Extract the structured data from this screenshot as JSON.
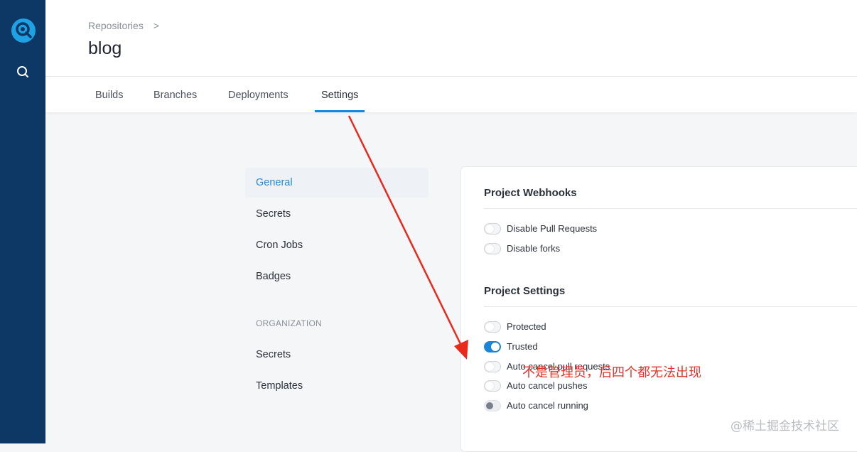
{
  "sidebar": {
    "logo_icon": "drone-logo-icon",
    "search_icon": "search-icon"
  },
  "header": {
    "breadcrumb": "Repositories",
    "breadcrumb_separator": ">",
    "title": "blog"
  },
  "tabs": [
    {
      "label": "Builds"
    },
    {
      "label": "Branches"
    },
    {
      "label": "Deployments"
    },
    {
      "label": "Settings",
      "active": true
    }
  ],
  "settings_nav": {
    "items": [
      {
        "label": "General",
        "active": true
      },
      {
        "label": "Secrets"
      },
      {
        "label": "Cron Jobs"
      },
      {
        "label": "Badges"
      }
    ],
    "org_section_label": "ORGANIZATION",
    "org_items": [
      {
        "label": "Secrets"
      },
      {
        "label": "Templates"
      }
    ]
  },
  "panel": {
    "webhooks_title": "Project Webhooks",
    "webhooks_options": [
      {
        "label": "Disable Pull Requests",
        "state": "off"
      },
      {
        "label": "Disable forks",
        "state": "off"
      }
    ],
    "settings_title": "Project Settings",
    "settings_options": [
      {
        "label": "Protected",
        "state": "off"
      },
      {
        "label": "Trusted",
        "state": "on"
      },
      {
        "label": "Auto cancel pull requests",
        "state": "off"
      },
      {
        "label": "Auto cancel pushes",
        "state": "off"
      },
      {
        "label": "Auto cancel running",
        "state": "disabled"
      }
    ]
  },
  "annotation": {
    "text": "不是管理员，后四个都无法出现",
    "color": "#e0342a"
  },
  "watermark": "@稀土掘金技术社区",
  "colors": {
    "sidebar_bg": "#0d3866",
    "accent": "#1a86d9",
    "logo": "#1ea2e4"
  }
}
